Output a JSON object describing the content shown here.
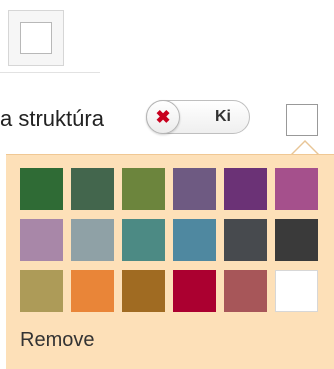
{
  "toolbar": {
    "label": "a struktúra",
    "toggle": {
      "knob_icon": "✖",
      "label": "Ki",
      "state_icon_name": "close-icon"
    }
  },
  "palette": {
    "colors": [
      "#2f6b35",
      "#43664d",
      "#6c853d",
      "#6e5a82",
      "#6b3276",
      "#a5508c",
      "#a887a8",
      "#8fa1a6",
      "#4c8a84",
      "#4f88a0",
      "#474a4e",
      "#3a3a3a",
      "#ad9b58",
      "#e98538",
      "#a06b22",
      "#ab0030",
      "#a75659",
      "#ffffff"
    ],
    "remove_label": "Remove"
  }
}
